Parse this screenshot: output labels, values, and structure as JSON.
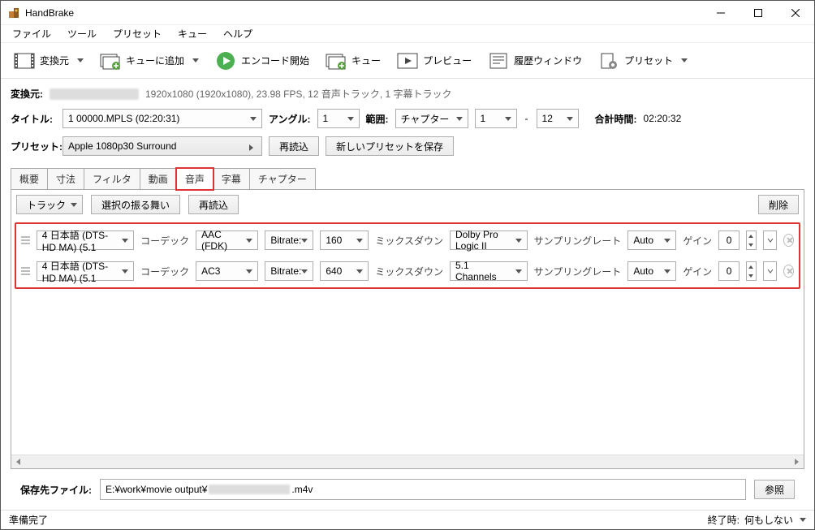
{
  "titlebar": {
    "title": "HandBrake"
  },
  "menu": {
    "file": "ファイル",
    "tools": "ツール",
    "presets": "プリセット",
    "queue": "キュー",
    "help": "ヘルプ"
  },
  "toolbar": {
    "source": "変換元",
    "addqueue": "キューに追加",
    "start": "エンコード開始",
    "queue": "キュー",
    "preview": "プレビュー",
    "activity": "履歴ウィンドウ",
    "presets": "プリセット"
  },
  "source": {
    "label": "変換元:",
    "info": "1920x1080 (1920x1080), 23.98 FPS, 12 音声トラック, 1 字幕トラック"
  },
  "titlerow": {
    "title_label": "タイトル:",
    "title_value": "1 00000.MPLS (02:20:31)",
    "angle_label": "アングル:",
    "angle_value": "1",
    "range_label": "範囲:",
    "range_type": "チャプター",
    "range_from": "1",
    "range_to": "12",
    "duration_label": "合計時間:",
    "duration_value": "02:20:32"
  },
  "presetrow": {
    "label": "プリセット:",
    "value": "Apple 1080p30 Surround",
    "reload": "再読込",
    "savenew": "新しいプリセットを保存"
  },
  "tabs": {
    "summary": "概要",
    "dimensions": "寸法",
    "filters": "フィルタ",
    "video": "動画",
    "audio": "音声",
    "subtitles": "字幕",
    "chapters": "チャプター"
  },
  "audiobar": {
    "track": "トラック",
    "behavior": "選択の振る舞い",
    "reload": "再読込",
    "clear": "削除"
  },
  "audio_labels": {
    "codec": "コーデック",
    "bitrate": "Bitrate:",
    "mixdown": "ミックスダウン",
    "samplerate": "サンプリングレート",
    "gain": "ゲイン"
  },
  "tracks": [
    {
      "source": "4 日本語 (DTS-HD MA) (5.1",
      "codec": "AAC (FDK)",
      "bitrate": "160",
      "mixdown": "Dolby Pro Logic II",
      "samplerate": "Auto",
      "gain": "0"
    },
    {
      "source": "4 日本語 (DTS-HD MA) (5.1",
      "codec": "AC3",
      "bitrate": "640",
      "mixdown": "5.1 Channels",
      "samplerate": "Auto",
      "gain": "0"
    }
  ],
  "savebar": {
    "label": "保存先ファイル:",
    "prefix": "E:¥work¥movie output¥",
    "suffix": ".m4v",
    "browse": "参照"
  },
  "statusbar": {
    "status": "準備完了",
    "done_label": "終了時:",
    "done_value": "何もしない"
  }
}
